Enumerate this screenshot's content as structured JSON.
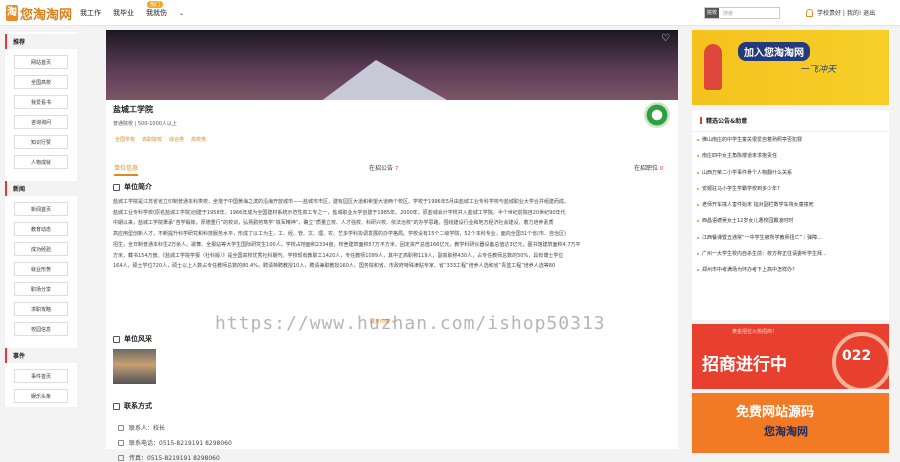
{
  "topbar": {
    "logo_char": "淘",
    "logo_text": "您淘淘网",
    "nav": [
      "我工作",
      "我毕业",
      "我就伤"
    ],
    "nav_badge": "热门",
    "search_select": "院校",
    "search_placeholder": "搜索",
    "user_text": "学校贵好 | 我的! 退出"
  },
  "sidebar": {
    "groups": [
      {
        "title": "推荐",
        "items": [
          "网站首页",
          "全国高校",
          "我爱看书",
          "咨询询问",
          "知识行赞",
          "人物成就"
        ]
      },
      {
        "title": "新闻",
        "items": [
          "新闻首页",
          "教育动态",
          "成功经验",
          "就业形势",
          "职场分享",
          "求职攻略",
          "校园信息"
        ]
      },
      {
        "title": "事件",
        "items": [
          "事件首页",
          "娱乐头条"
        ]
      }
    ]
  },
  "school": {
    "name": "盐城工学院",
    "info": "普通院校 | 500-1000人以上",
    "tags": [
      "全国学校",
      "高职院校",
      "综合类",
      "高校类"
    ]
  },
  "tabs": {
    "t1": "单位信息",
    "t2": "在招公告",
    "t2_count": "7",
    "t3": "在招职位",
    "t3_count": "0"
  },
  "sections": {
    "intro_title": "单位简介",
    "photos_title": "单位风采",
    "contact_title": "联系方式"
  },
  "intro_lines": [
    "盐城工学院是江苏省省立印制普通本科类校，坐落于中国黄海之滨的沿海开放城市——盐城市市区，建有园区大道和希望大道两个校区。学校于1996年5月由盐城工业专科学校与盐城职业大学合并组建而成。",
    "盐城工业专科学校(原名盐城工学院)创建于1958年，1966年成为全国建材系统示范性高工专之一，盐城职业大学创建于1985年。2000年，原盐城会计学校并入盐城工学院。半个世纪前院自20世纪90年代",
    "中期以来，盐城工学院秉承“苦学锻炼，厚德重行”的校训，弘扬勤劳笃学“铁军精神”，确立“质量立校、人才强校、科研兴校、依法治校”的办学思路，围绕建设行业和地方经济社会建设，着力培养素质",
    "高应用型创新人才，不断提升科学研究和科技服务水平，形成了以工为主，工、经、管、文、理、农、艺多学科协调发展的办学格局。学校设有15个二级学院，52个本科专业，面向全国31个省(市、自治区)",
    "招生，全日制普通本科生2万余人。歌舞、全报站等大学生国际研究生100人。学校占地面积2334亩，校舍建筑面积57万平方米，固定资产总值166亿元，教学科研仪器设备总值达3亿元，图书馆建筑面积4.7万平",
    "方米，藏书154万册。《盐城工学院学报（社科版）》是全国高校优秀社科期刊。学校现有教职工1420人，专任教师1099人，其中正高职称119人，副高职称430人，占专任教师总数的50%，具有博士学位",
    "164人，硕士学位720人，硕士以上人数占专任教师总数的80.4%。聘请特聘教授10人，聘请兼职教授160人。国务院和省、市政府特殊津贴专家、省“333工程”培养人选和省“青蓝工程”培养人选等80"
  ],
  "more_text": "展开内容 ∨",
  "contacts": [
    {
      "label": "联系人：校长"
    },
    {
      "label": "联系电话：0515-8219191 8298060"
    },
    {
      "label": "传真：0515-8219191 8298060"
    }
  ],
  "watermark": "https://www.huzhan.com/ishop50313",
  "right": {
    "ad1_title": "加入您淘淘网",
    "ad1_sub": "一飞冲天",
    "notice_title": "精选公告&助意",
    "notices": [
      "佛山南庄的中学生童关很爱自着熟照亭否犯罪",
      "南庄四中女主角陈楼道未求抱责任",
      "山西万荣二小学事件骨个人物翻什么关系",
      "安顺驻马小学生学霸学校到多少年?",
      "老师开车撞人害件始末 指对副栏数学车将女童撞死",
      "西昌语德吴女士12岁女儿遭校园霸凌时时",
      "江西餐课暨五通常“一中学生被所学教师扭亡”｜弹障...",
      "广州一大学生校内自杀生前：校方称正往请委听学生拜...",
      "郑州市中考满场为环办考下上高中怎样办?"
    ],
    "ad2_top": "黄金招位火热招商！",
    "ad2_big": "招商进行中",
    "ad2_num": "022",
    "ad3_text": "免费网站源码",
    "ad3_logo": "您淘淘网"
  }
}
